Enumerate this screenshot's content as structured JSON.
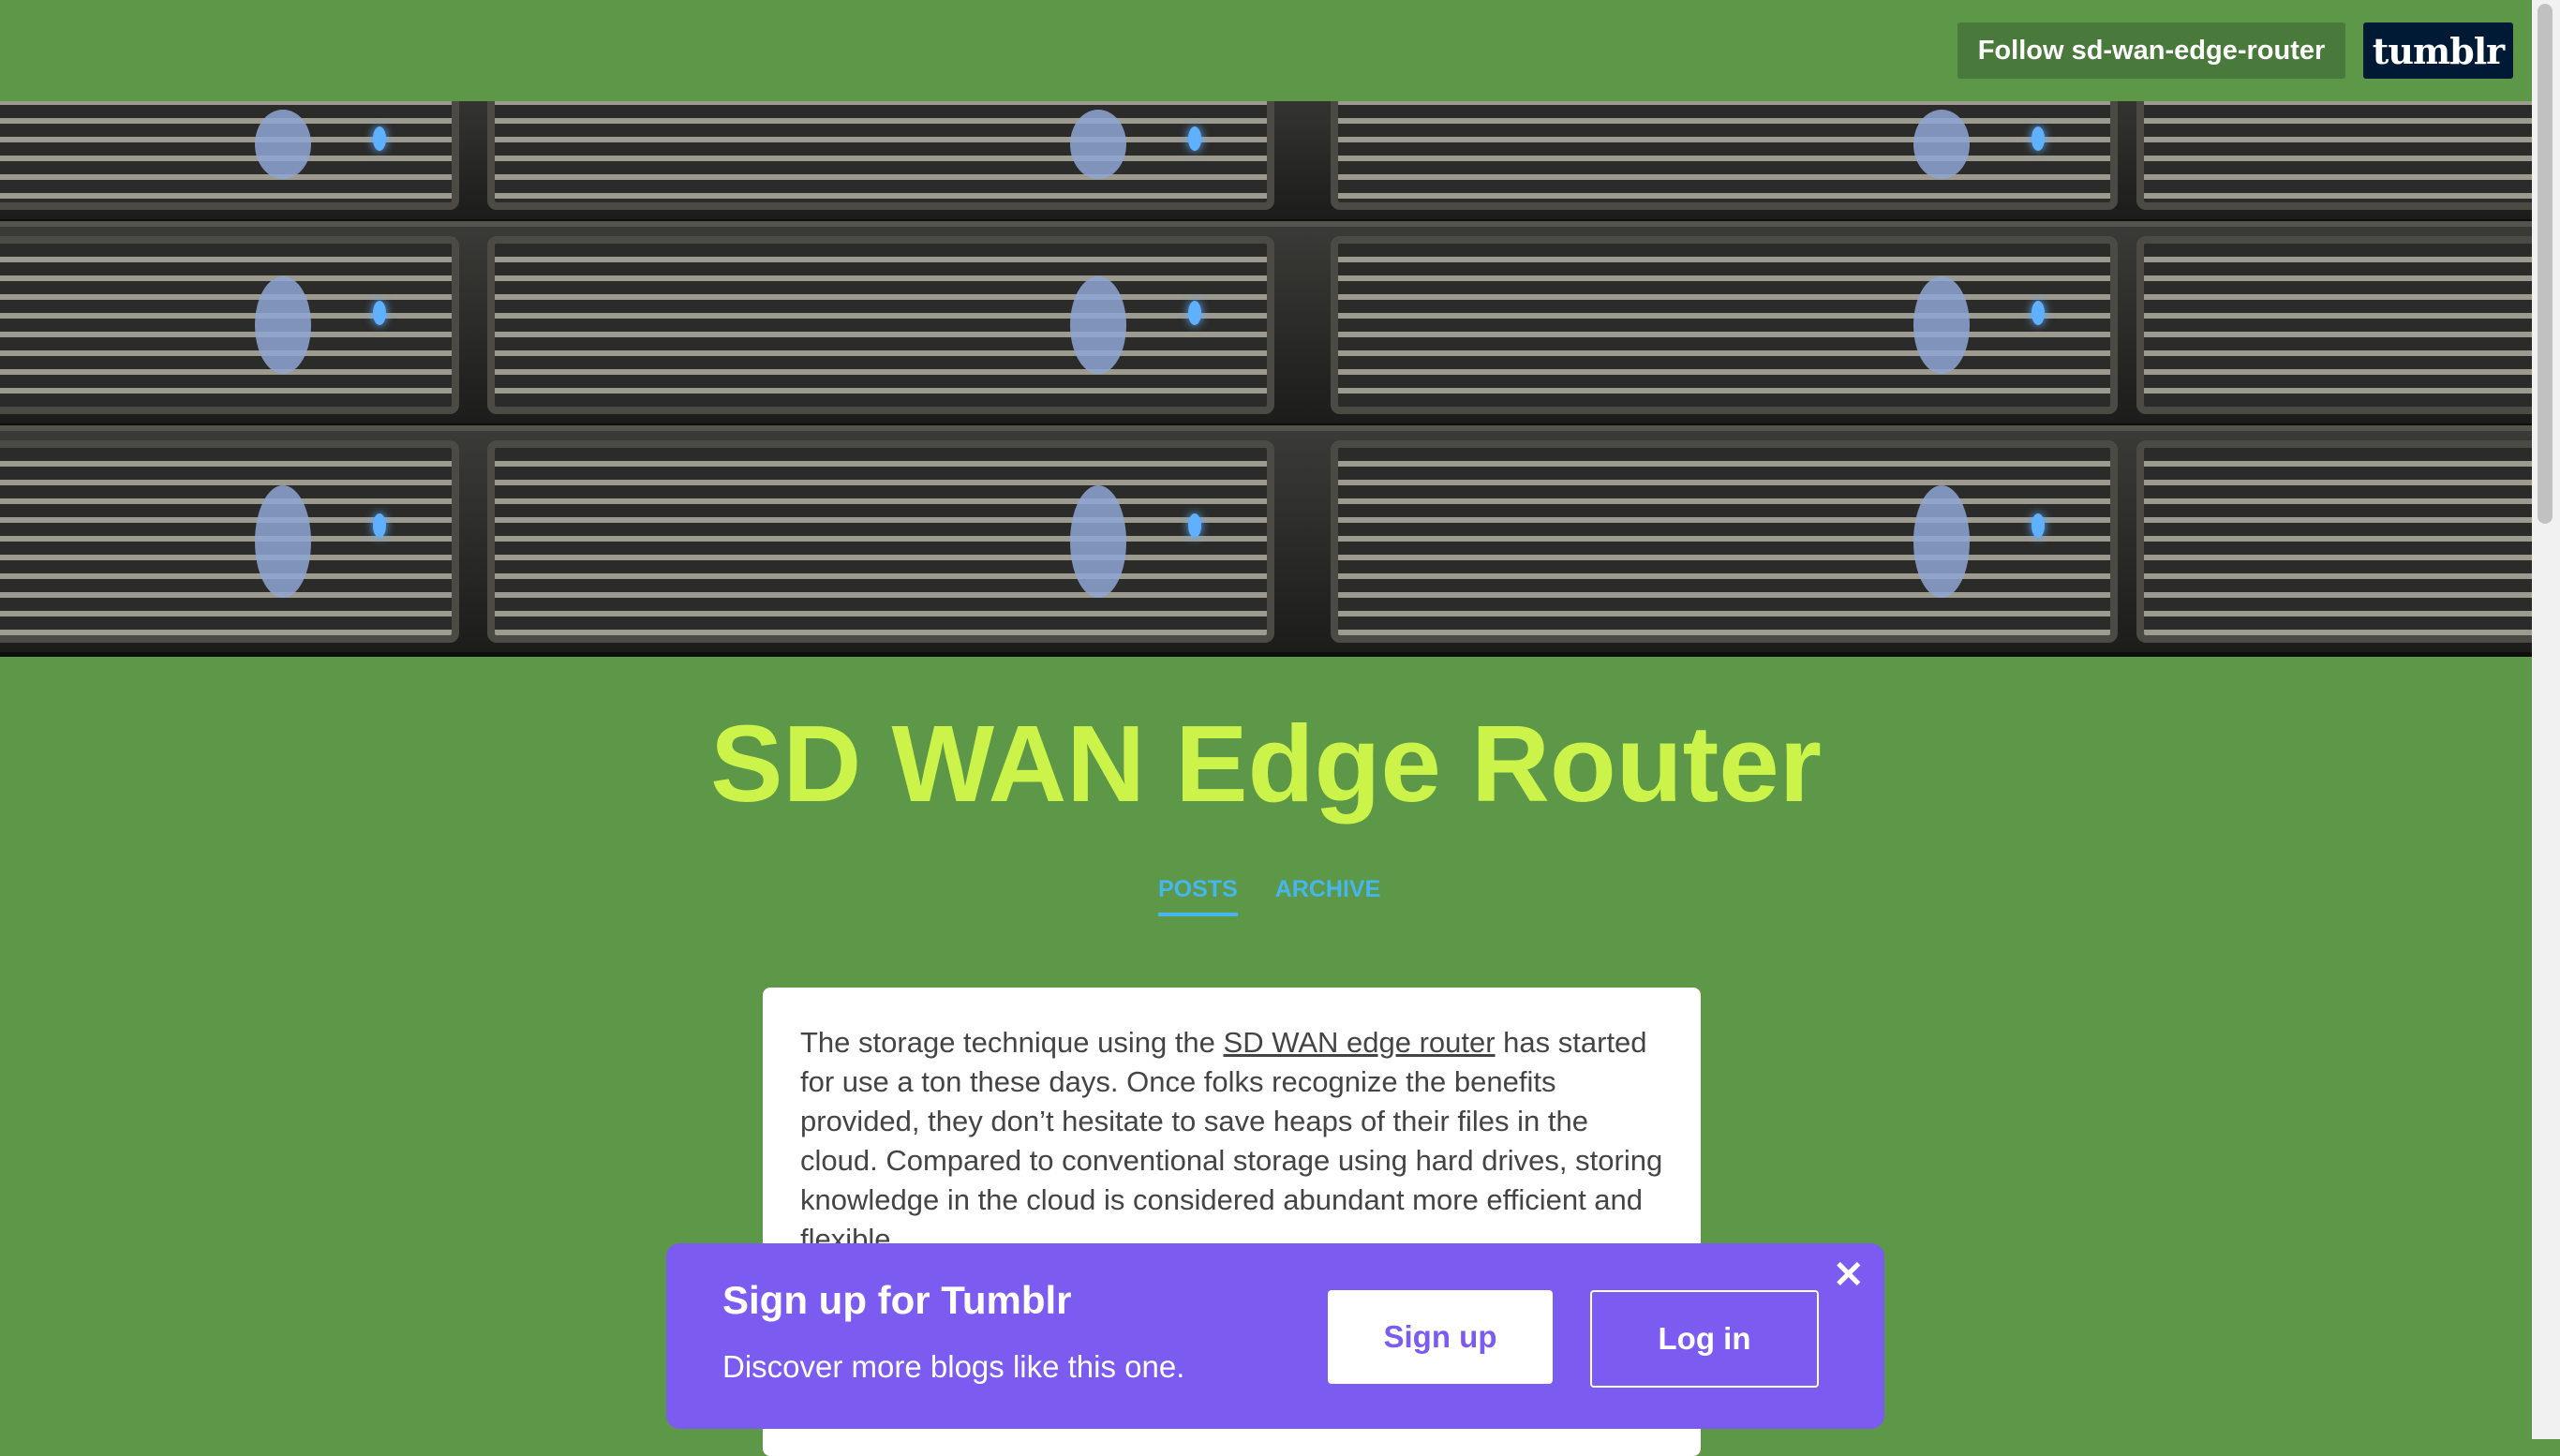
{
  "topbar": {
    "follow_label": "Follow sd-wan-edge-router",
    "logo_text": "tumblr"
  },
  "blog": {
    "title": "SD WAN Edge Router",
    "accent_color": "#cbf34a",
    "background_color": "#5d9848"
  },
  "nav": {
    "tabs": [
      {
        "label": "POSTS",
        "active": true
      },
      {
        "label": "ARCHIVE",
        "active": false
      }
    ]
  },
  "post": {
    "text_before_link": "The storage technique using the ",
    "link_text": "SD WAN edge router",
    "text_after_link": " has started for use a ton these days. Once folks recognize the benefits provided, they don’t hesitate to save heaps of their files in the cloud. Compared to conventional storage using hard drives, storing knowledge in the cloud is considered abundant more efficient and flexible."
  },
  "signup_banner": {
    "title": "Sign up for Tumblr",
    "subtitle": "Discover more blogs like this one.",
    "signup_label": "Sign up",
    "login_label": "Log in",
    "close_icon": "close-icon",
    "color": "#7c5cf0"
  }
}
